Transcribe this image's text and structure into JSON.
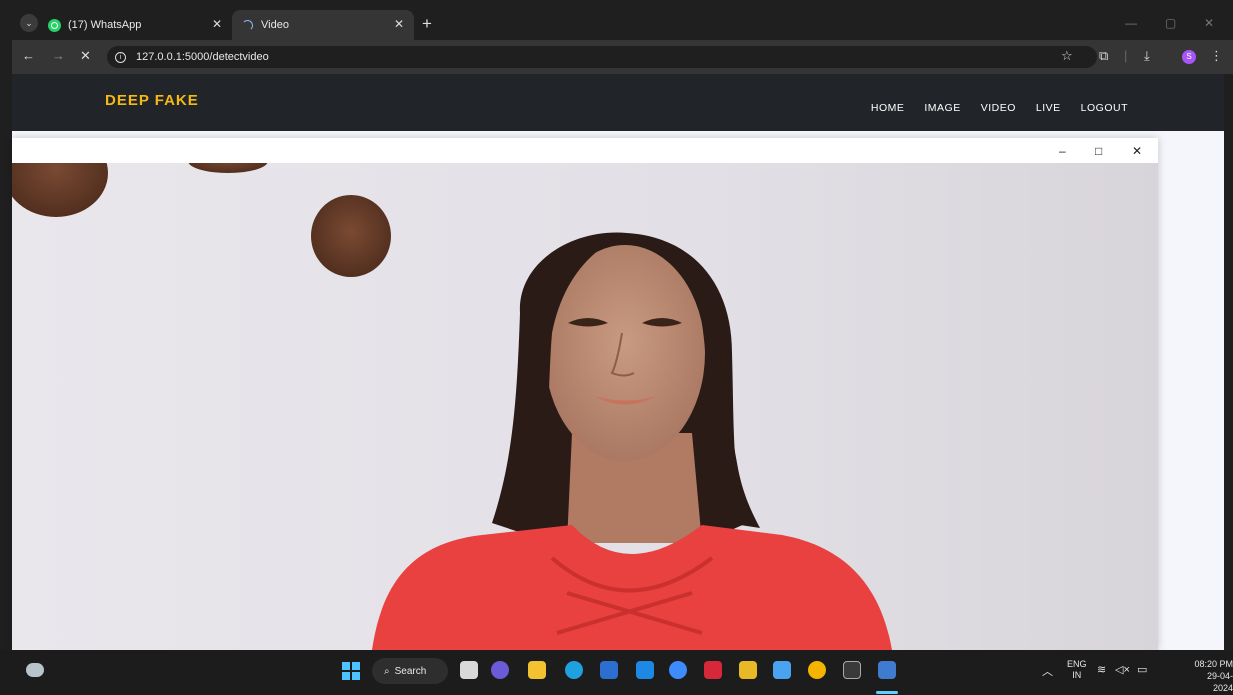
{
  "browser": {
    "tabs": [
      {
        "title": "(17) WhatsApp",
        "active": false
      },
      {
        "title": "Video",
        "active": true
      }
    ],
    "new_tab": "+",
    "url": "127.0.0.1:5000/detectvideo",
    "profile_initial": "S"
  },
  "site": {
    "brand": "DEEP FAKE",
    "nav": [
      "HOME",
      "IMAGE",
      "VIDEO",
      "LIVE",
      "LOGOUT"
    ]
  },
  "video_window": {
    "controls": {
      "minimize": "–",
      "maximize": "□",
      "close": "✕"
    }
  },
  "taskbar": {
    "search_label": "Search",
    "lang_top": "ENG",
    "lang_bottom": "IN",
    "time": "08:20 PM",
    "date": "29-04-2024"
  },
  "colors": {
    "brand": "#f5b915",
    "navbar": "#212529",
    "dress": "#e8413f"
  }
}
